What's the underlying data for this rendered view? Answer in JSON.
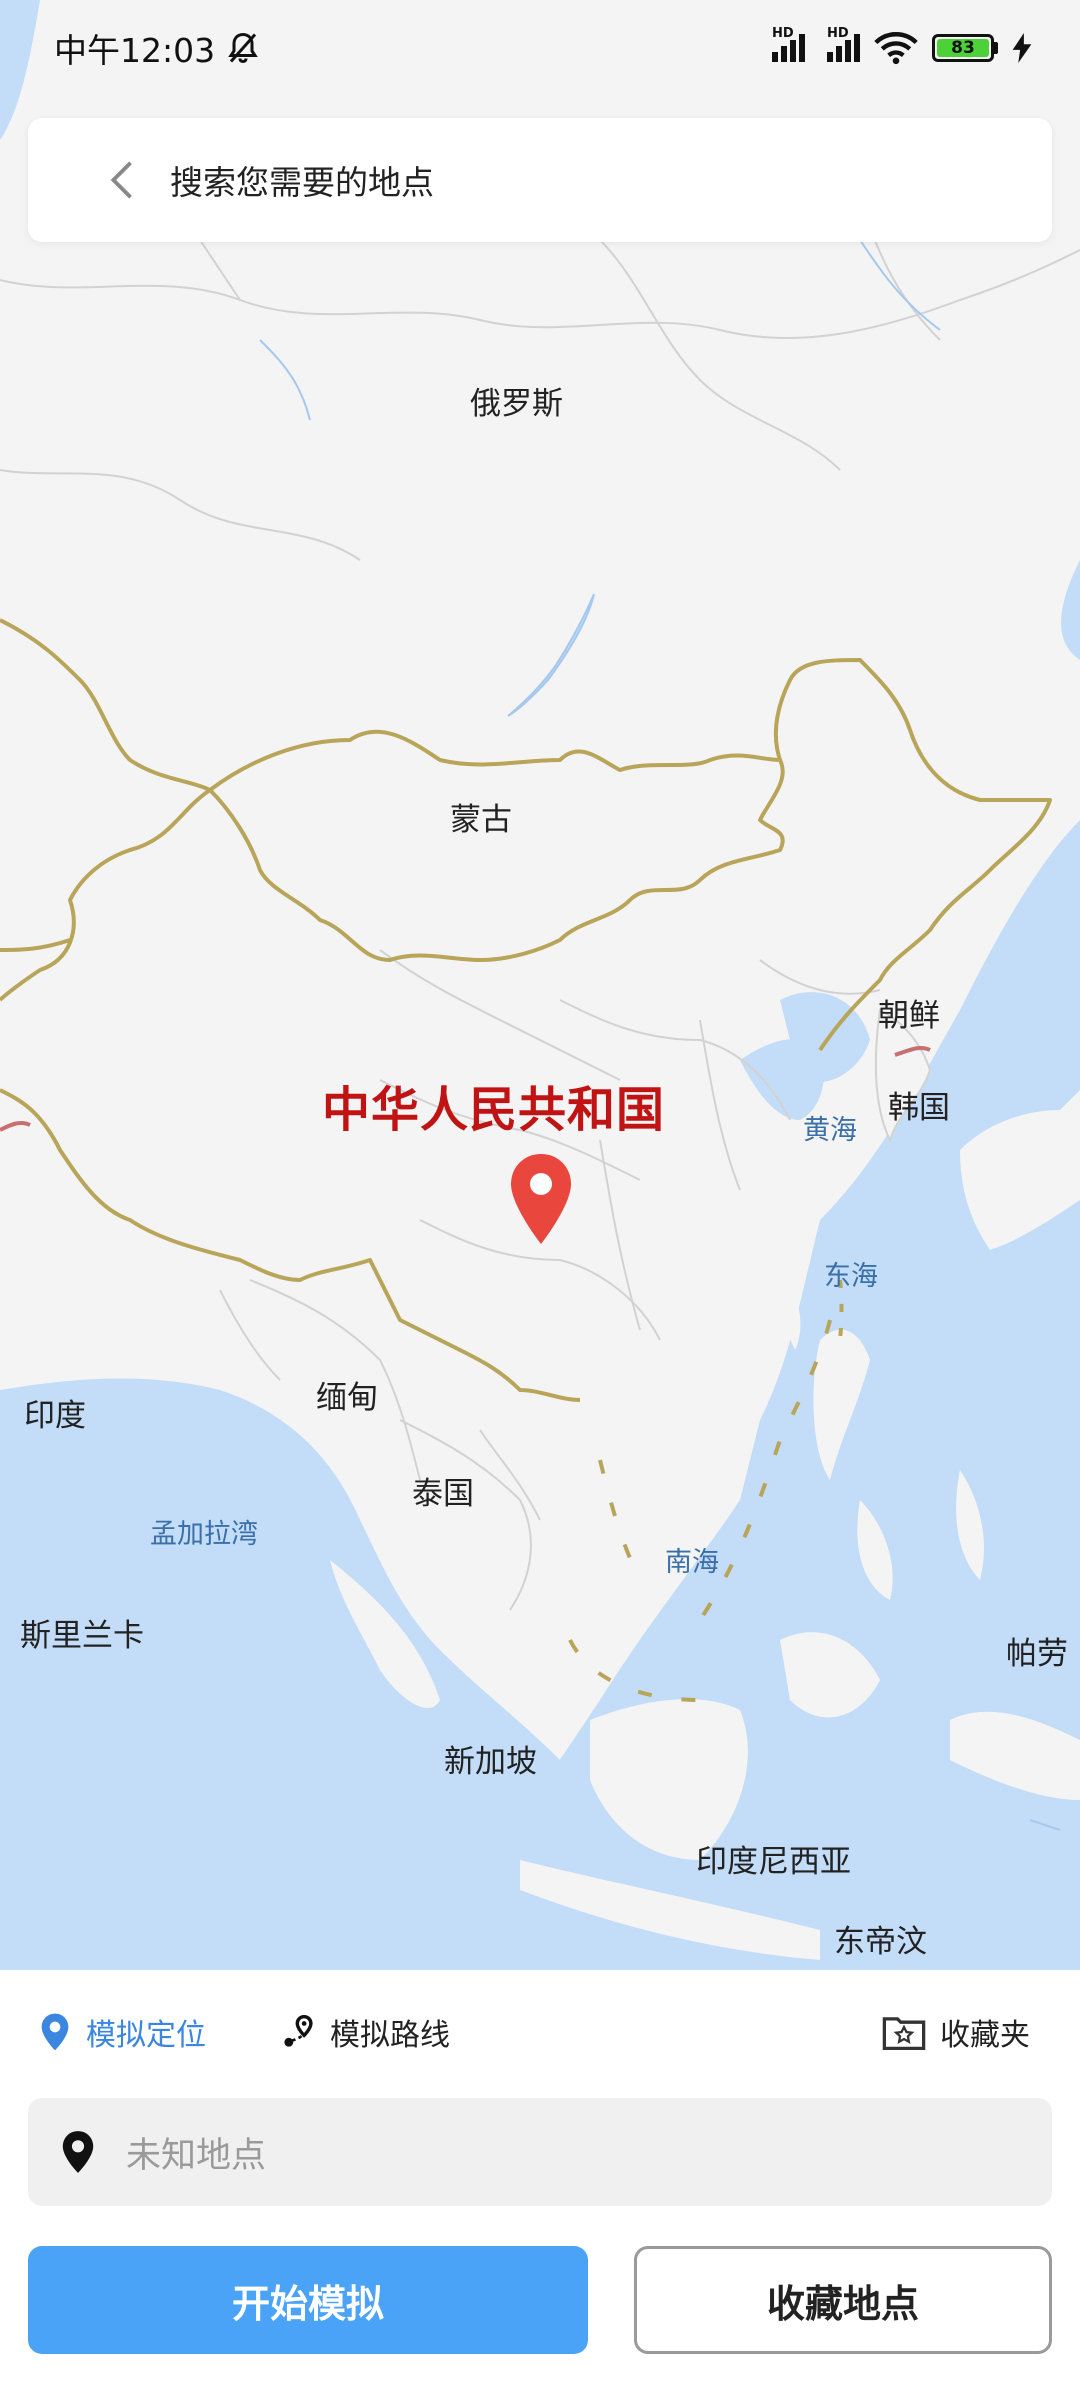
{
  "status_bar": {
    "time": "中午12:03",
    "battery": "83",
    "signal_label_1": "HD",
    "signal_label_2": "HD"
  },
  "search": {
    "placeholder": "搜索您需要的地点"
  },
  "map": {
    "labels": {
      "russia": "俄罗斯",
      "mongolia": "蒙古",
      "china": "中华人民共和国",
      "north_korea": "朝鲜",
      "south_korea": "韩国",
      "yellow_sea": "黄海",
      "east_sea": "东海",
      "south_sea": "南海",
      "myanmar": "缅甸",
      "thailand": "泰国",
      "india": "印度",
      "bay_of_bengal": "孟加拉湾",
      "sri_lanka": "斯里兰卡",
      "singapore": "新加坡",
      "indonesia": "印度尼西亚",
      "east_timor": "东帝汶",
      "palau": "帕劳"
    },
    "colors": {
      "land": "#f4f4f4",
      "water": "#c3dcf7",
      "border_major": "#b8a55a",
      "border_minor": "#d2d2d2",
      "pin": "#e9473d"
    }
  },
  "panel": {
    "tabs": [
      {
        "label": "模拟定位",
        "icon": "location-pin-icon",
        "active": true
      },
      {
        "label": "模拟路线",
        "icon": "route-icon",
        "active": false
      }
    ],
    "favorites_label": "收藏夹",
    "location_value": "未知地点",
    "start_button": "开始模拟",
    "save_button": "收藏地点",
    "accent_color": "#4aa3f6"
  }
}
